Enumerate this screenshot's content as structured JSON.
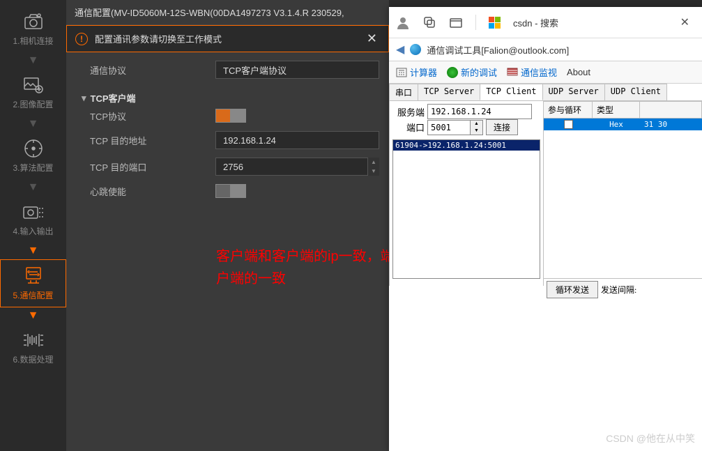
{
  "sidebar": {
    "items": [
      {
        "label": "1.相机连接"
      },
      {
        "label": "2.图像配置"
      },
      {
        "label": "3.算法配置"
      },
      {
        "label": "4.输入输出"
      },
      {
        "label": "5.通信配置"
      },
      {
        "label": "6.数据处理"
      }
    ]
  },
  "panel": {
    "title": "通信配置(MV-ID5060M-12S-WBN(00DA1497273 V3.1.4.R 230529,",
    "alert": "配置通讯参数请切换至工作模式",
    "protocol_label": "通信协议",
    "protocol_value": "TCP客户端协议",
    "section_title": "TCP客户端",
    "tcp_protocol_label": "TCP协议",
    "target_addr_label": "TCP 目的地址",
    "target_addr_value": "192.168.1.24",
    "target_port_label": "TCP 目的端口",
    "target_port_value": "2756",
    "heartbeat_label": "心跳使能"
  },
  "annotation": "客户端和客户端的ip一致，端口的是客户端和服务端的一致，服务端和客户端的一致",
  "browser": {
    "titlebar_text": "csdn - 搜索",
    "tool_title": "通信调试工具[Falion@outlook.com]",
    "menu": {
      "calc": "计算器",
      "new_debug": "新的调试",
      "monitor": "通信监视",
      "about": "About"
    },
    "tabs": {
      "serial": "串口",
      "tcp_server": "TCP Server",
      "tcp_client": "TCP Client",
      "udp_server": "UDP Server",
      "udp_client": "UDP Client"
    },
    "conn": {
      "server_label": "服务端",
      "server_value": "192.168.1.24",
      "port_label": "端口",
      "port_value": "5001",
      "connect_btn": "连接",
      "list_item": "61904->192.168.1.24:5001"
    },
    "table": {
      "h1": "参与循环",
      "h2": "类型",
      "r1_type": "Hex",
      "r1_data": "31 30"
    },
    "send": {
      "loop_btn": "循环发送",
      "interval_label": "发送间隔:"
    }
  },
  "watermark": "CSDN @他在从中笑"
}
